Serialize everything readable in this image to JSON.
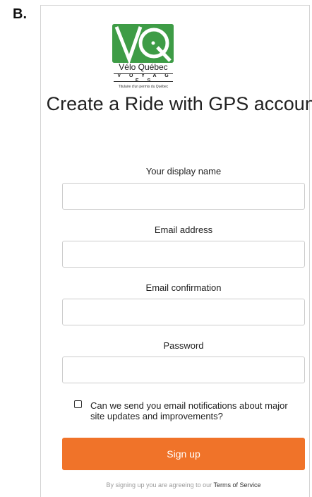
{
  "figure_label": "B.",
  "logo": {
    "name": "Vélo Québec",
    "subtitle": "V O Y A G E S",
    "permit_text": "Titulaire d'un permis du Québec",
    "brand_green": "#3e9c46"
  },
  "form": {
    "title": "Create a Ride with GPS account",
    "fields": [
      {
        "label": "Your display name",
        "value": ""
      },
      {
        "label": "Email address",
        "value": ""
      },
      {
        "label": "Email confirmation",
        "value": ""
      },
      {
        "label": "Password",
        "value": ""
      }
    ],
    "newsletter_checkbox": {
      "label": "Can we send you email notifications about major site updates and improvements?",
      "checked": false
    },
    "submit_label": "Sign up",
    "submit_color": "#f07329",
    "terms_prefix": "By signing up you are agreeing to our",
    "terms_link": "Terms of Service"
  }
}
